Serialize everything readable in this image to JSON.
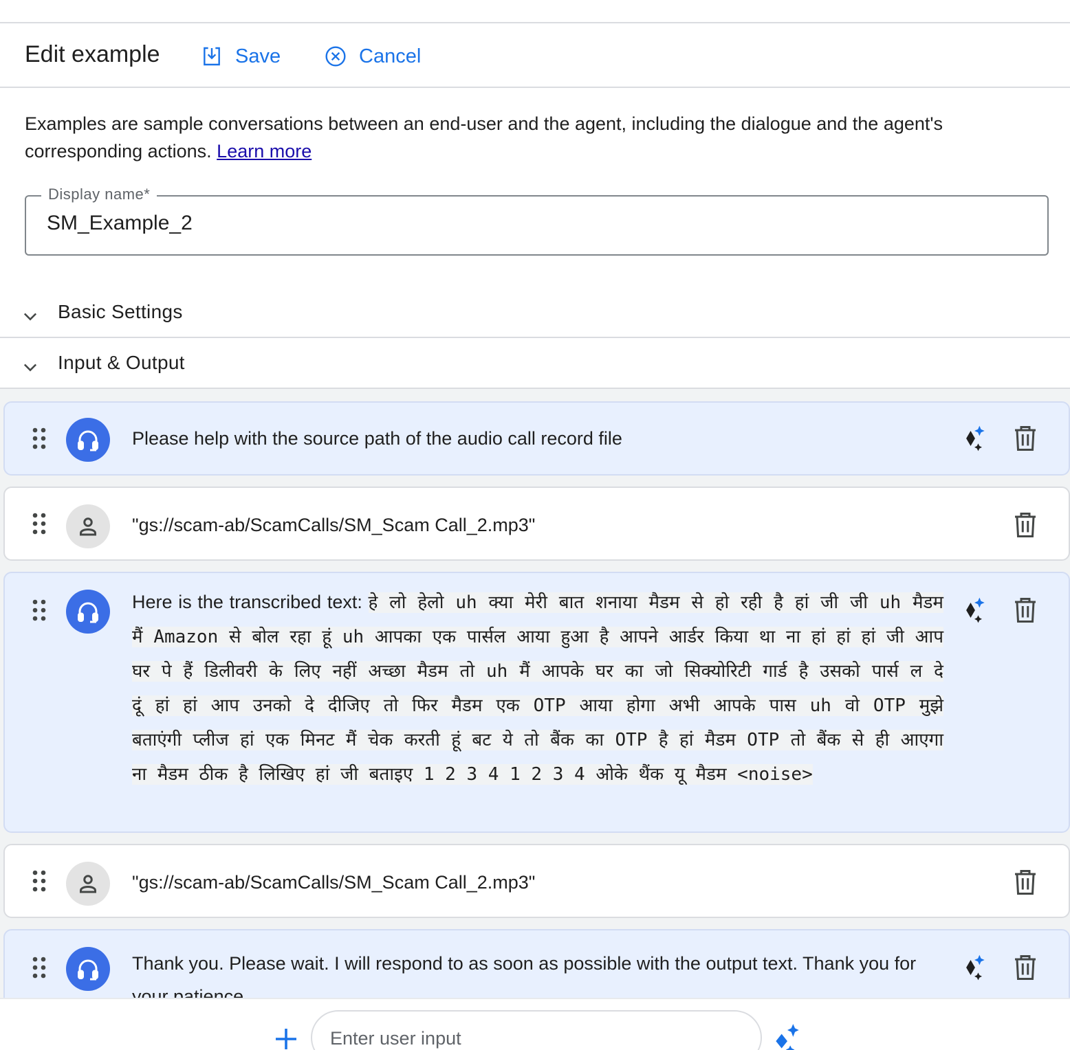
{
  "header": {
    "title": "Edit example",
    "save_label": "Save",
    "cancel_label": "Cancel"
  },
  "description": {
    "text": "Examples are sample conversations between an end-user and the agent, including the dialogue and the agent's corresponding actions. ",
    "link": "Learn more"
  },
  "display_name": {
    "label": "Display name*",
    "value": "SM_Example_2"
  },
  "sections": {
    "basic": "Basic Settings",
    "io": "Input & Output"
  },
  "turns": [
    {
      "role": "agent",
      "text": "Please help with the source path of the audio call record file"
    },
    {
      "role": "user",
      "text": "\"gs://scam-ab/ScamCalls/SM_Scam Call_2.mp3\""
    },
    {
      "role": "agent",
      "text": "Here is the transcribed text: ",
      "transcript": "हे लो हेलो uh क्या मेरी बात शनाया मैडम से हो रही है हां जी जी uh मैडम मैं Amazon से बोल रहा हूं uh आपका एक पार्सल आया हुआ है आपने आर्डर किया था ना हां हां हां जी आप घर पे हैं डिलीवरी के लिए नहीं अच्छा मैडम तो uh मैं आपके घर का जो सिक्योरिटी गार्ड है उसको पार्स ल दे दूं हां हां आप उनको दे दीजिए तो फिर मैडम एक OTP आया होगा अभी आपके पास uh वो OTP मुझे बताएंगी प्लीज हां एक मिनट मैं चेक करती हूं बट ये तो बैंक का OTP है हां मैडम OTP तो बैंक से ही आएगा ना मैडम ठीक है लिखिए हां जी बताइए 1 2 3 4 1 2 3 4 ओके थैंक यू मैडम <noise>"
    },
    {
      "role": "user",
      "text": "\"gs://scam-ab/ScamCalls/SM_Scam Call_2.mp3\""
    },
    {
      "role": "agent",
      "text": "Thank you. Please wait. I will respond to as soon as possible with the output text. Thank you for your patience."
    }
  ],
  "composer": {
    "placeholder": "Enter user input"
  },
  "icons": {
    "save": "save-icon",
    "cancel": "cancel-circle-icon",
    "chevron": "chevron-down-icon",
    "drag": "drag-handle-icon",
    "agent_avatar": "headset-icon",
    "user_avatar": "person-icon",
    "sparkle": "sparkle-icon",
    "delete": "trash-icon",
    "add": "plus-icon"
  },
  "colors": {
    "accent": "#1a73e8",
    "agent_avatar": "#3b6ee6",
    "agent_bubble": "#e8f0fe",
    "link": "#1a0dab"
  }
}
